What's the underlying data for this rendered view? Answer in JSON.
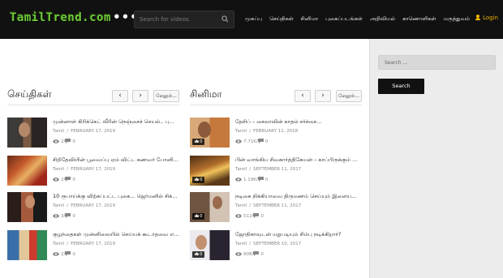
{
  "header": {
    "logo_text": "TamilTrend.com",
    "more_dots": "•••",
    "search_placeholder": "Search for videos",
    "menu": [
      "முகப்பு",
      "செய்திகள்",
      "சினிமா",
      "புகைப்படங்கள்",
      "அறிவியல்",
      "காணொளிகள்",
      "மருத்துவம்"
    ],
    "login_label": "Login",
    "accent_color": "#6fc93a",
    "login_color": "#f0b400"
  },
  "sections": [
    {
      "title": "செய்திகள்",
      "prev": "‹",
      "next": "›",
      "more_label": "மேலும்...",
      "items": [
        {
          "title": "முன்னாள் கிரிக்கெட் வீரின் நெஞ்சைச் செயல்.. புகைப்...",
          "author": "Tamil",
          "date": "FEBRUARY 17, 2019",
          "views": "2",
          "comments": "0"
        },
        {
          "title": "சிறிதேவியின் பூவைப்பு ஏம் விட்ட கணவர் போனி க...",
          "author": "Tamil",
          "date": "FEBRUARY 17, 2019",
          "views": "2",
          "comments": "0"
        },
        {
          "title": "10 ரூபாய்க்கு விற்கப்பட்ட புகை... ஜெர்மனில் சிக்கிய ...",
          "author": "Tamil",
          "date": "FEBRUARY 17, 2019",
          "views": "3",
          "comments": "0"
        },
        {
          "title": "குழந்தைகள் முன்னிலையில் செய்யக் கூடாதவை எ...",
          "author": "Tamil",
          "date": "FEBRUARY 17, 2019",
          "views": "2",
          "comments": "0"
        }
      ]
    },
    {
      "title": "சினிமா",
      "prev": "‹",
      "next": "›",
      "more_label": "மேலும்...",
      "items": [
        {
          "title": "தேசிப் – சைலாவின் காதல் சர்ச்சை...",
          "author": "Tamil",
          "date": "FEBRUARY 11, 2018",
          "views": "7.71K",
          "comments": "0",
          "badge": "0"
        },
        {
          "title": "பின் வாங்கிய சிவகார்த்திகேயன் – காப்பிருக்கும் வி௫...",
          "author": "Tamil",
          "date": "SEPTEMBER 11, 2017",
          "views": "1.19K",
          "comments": "0",
          "badge": "0"
        },
        {
          "title": "நடிகை நிக்கியாவை திருமணம் செய்யும் இளையமை...",
          "author": "Tamil",
          "date": "SEPTEMBER 11, 2017",
          "views": "512",
          "comments": "0",
          "badge": "0"
        },
        {
          "title": "ஜோதிகாவுடன் மறுபடியும் சிம்பு நடிக்கிறார்?",
          "author": "Tamil",
          "date": "SEPTEMBER 10, 2017",
          "views": "908",
          "comments": "0",
          "badge": "0"
        }
      ]
    }
  ],
  "sidebar": {
    "search_placeholder": "Search ...",
    "search_button": "Search"
  }
}
